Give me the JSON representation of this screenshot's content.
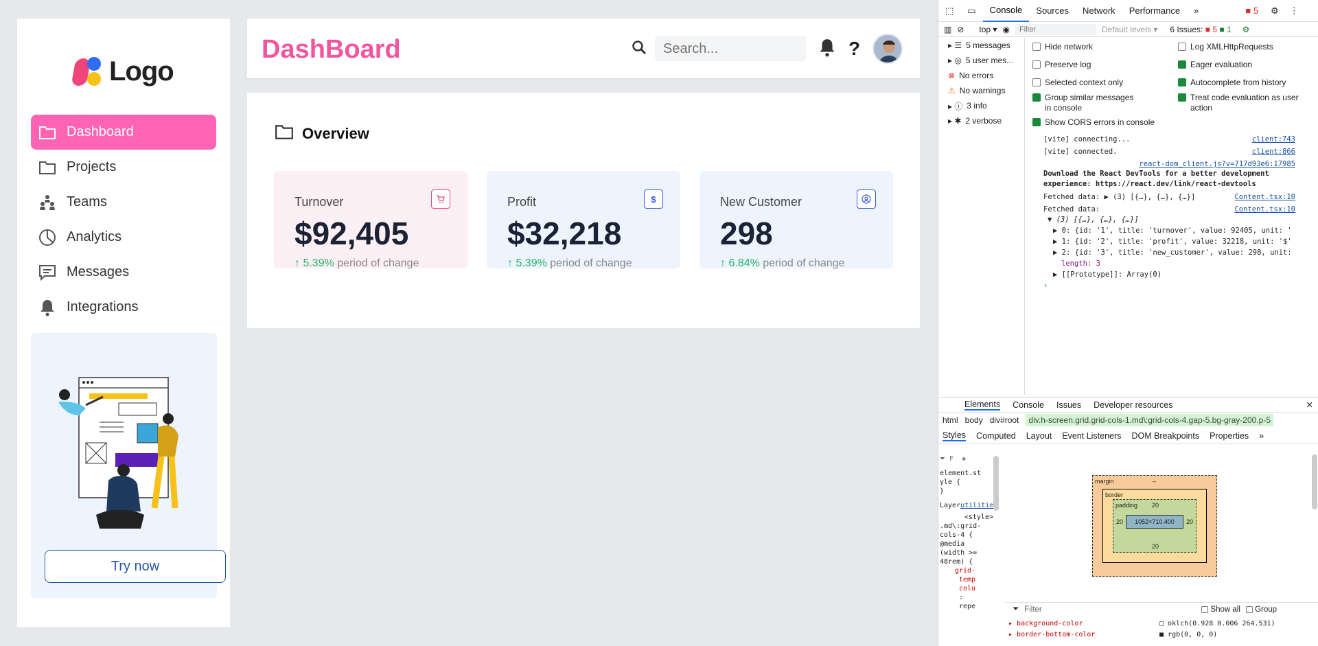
{
  "sidebar": {
    "logo_text": "Logo",
    "items": [
      {
        "label": "Dashboard",
        "icon": "folder-icon",
        "active": true
      },
      {
        "label": "Projects",
        "icon": "folder-icon",
        "active": false
      },
      {
        "label": "Teams",
        "icon": "team-icon",
        "active": false
      },
      {
        "label": "Analytics",
        "icon": "pie-chart-icon",
        "active": false
      },
      {
        "label": "Messages",
        "icon": "message-icon",
        "active": false
      },
      {
        "label": "Integrations",
        "icon": "bell-icon",
        "active": false
      }
    ],
    "promo_button": "Try now"
  },
  "header": {
    "title": "DashBoard",
    "search_placeholder": "Search...",
    "help": "?"
  },
  "overview": {
    "title": "Overview",
    "cards": [
      {
        "label": "Turnover",
        "value": "$92,405",
        "pct": "↑ 5.39%",
        "suffix": "period of change",
        "icon": "cart-icon",
        "bg": "#fdf0f4",
        "accent": "#f0457a"
      },
      {
        "label": "Profit",
        "value": "$32,218",
        "pct": "↑ 5.39%",
        "suffix": "period of change",
        "icon": "dollar-icon",
        "bg": "#eef4fd",
        "accent": "#3b5bdb"
      },
      {
        "label": "New Customer",
        "value": "298",
        "pct": "↑ 6.84%",
        "suffix": "period of change",
        "icon": "user-circle-icon",
        "bg": "#eef4fd",
        "accent": "#3b5bdb"
      }
    ]
  },
  "devtools": {
    "tabs": [
      "Console",
      "Sources",
      "Network",
      "Performance"
    ],
    "active_tab": "Console",
    "error_count": "5",
    "context": "top",
    "filter_placeholder": "Filter",
    "levels": "Default levels",
    "issues": "6 Issues:",
    "issues_err": "5",
    "issues_info": "1",
    "sidebar": [
      "5 messages",
      "5 user mes...",
      "No errors",
      "No warnings",
      "3 info",
      "2 verbose"
    ],
    "options_left": [
      "Hide network",
      "Preserve log",
      "Selected context only",
      "Group similar messages in console",
      "Show CORS errors in console"
    ],
    "options_right": [
      "Log XMLHttpRequests",
      "Eager evaluation",
      "Autocomplete from history",
      "Treat code evaluation as user action"
    ],
    "log": [
      {
        "text": "[vite] connecting...",
        "src": "client:743"
      },
      {
        "text": "[vite] connected.",
        "src": "client:866"
      },
      {
        "text": "",
        "src": "react-dom_client.js?v=717d93e6:17985"
      },
      {
        "text": "Download the React DevTools for a better development experience: https://react.dev/link/react-devtools",
        "src": ""
      },
      {
        "text": "Fetched data: ▶ (3) [{…}, {…}, {…}]",
        "src": "Content.tsx:10"
      },
      {
        "text": "Fetched data:",
        "src": "Content.tsx:10"
      },
      {
        "text": "▼ (3) [{…}, {…}, {…}]",
        "src": ""
      },
      {
        "text": "▶ 0: {id: '1', title: 'turnover', value: 92405, unit: '",
        "src": ""
      },
      {
        "text": "▶ 1: {id: '2', title: 'profit', value: 32218, unit: '$'",
        "src": ""
      },
      {
        "text": "▶ 2: {id: '3', title: 'new_customer', value: 298, unit:",
        "src": ""
      },
      {
        "text": "length: 3",
        "src": ""
      },
      {
        "text": "▶ [[Prototype]]: Array(0)",
        "src": ""
      }
    ],
    "bottom_tabs": [
      "Elements",
      "Console",
      "Issues",
      "Developer resources"
    ],
    "breadcrumb": [
      "html",
      "body",
      "div#root",
      "div.h-screen.grid.grid-cols-1.md\\:grid-cols-4.gap-5.bg-gray-200.p-5"
    ],
    "style_tabs": [
      "Styles",
      "Computed",
      "Layout",
      "Event Listeners",
      "DOM Breakpoints",
      "Properties"
    ],
    "styles_text": [
      "element.st",
      "yle {",
      "}",
      "Layer",
      "utilities",
      "<style>",
      ".md\\:grid-",
      "cols-4 {",
      "@media",
      "(width >=",
      "48rem) {",
      "grid-",
      "temp",
      "colu",
      ":",
      "repe"
    ],
    "box": {
      "margin": "margin",
      "border": "border",
      "padding": "padding",
      "pad_val": "20",
      "content": "1052×710.400",
      "dash": "–"
    },
    "computed_filter": "Filter",
    "show_all": "Show all",
    "group": "Group",
    "props": [
      {
        "name": "background-color",
        "value": "oklch(0.928 0.006 264.531)"
      },
      {
        "name": "border-bottom-color",
        "value": "rgb(0, 0, 0)"
      }
    ]
  }
}
